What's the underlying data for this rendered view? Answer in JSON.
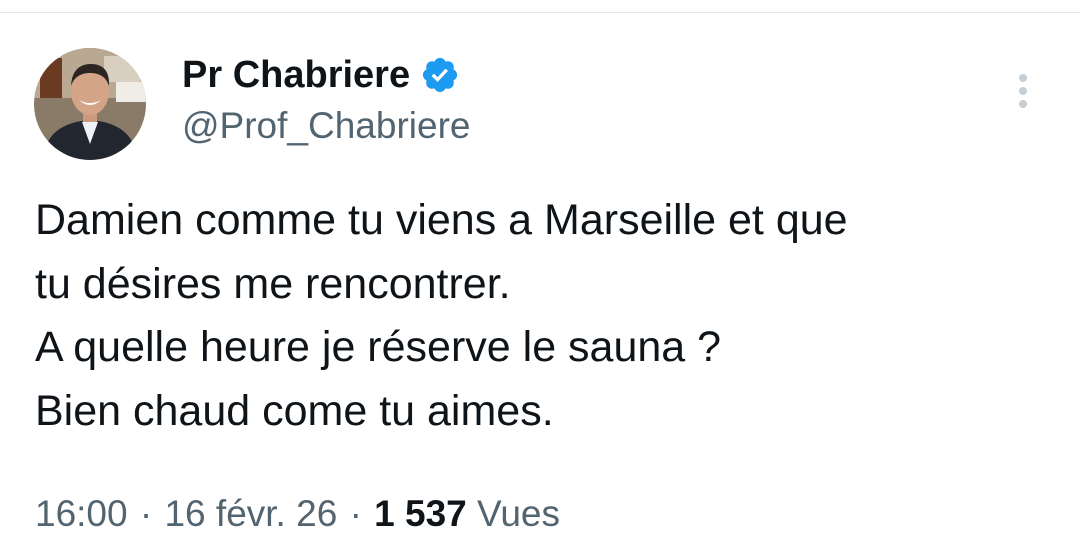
{
  "author": {
    "display_name": "Pr Chabriere",
    "handle": "@Prof_Chabriere",
    "verified": true,
    "avatar_icon": "profile-photo",
    "verified_icon": "verified-badge-icon"
  },
  "tweet": {
    "lines": [
      "Damien comme tu viens a Marseille et que",
      "tu désires me rencontrer.",
      "A quelle heure je réserve le sauna ?",
      "Bien chaud come tu aimes."
    ]
  },
  "meta": {
    "time": "16:00",
    "separator": "·",
    "date": "16 févr. 26",
    "views_count": "1 537",
    "views_label": "Vues"
  },
  "colors": {
    "text_primary": "#0f1419",
    "text_secondary": "#536471",
    "verified_blue": "#1d9bf0",
    "more_dots": "#c4cfd6"
  }
}
